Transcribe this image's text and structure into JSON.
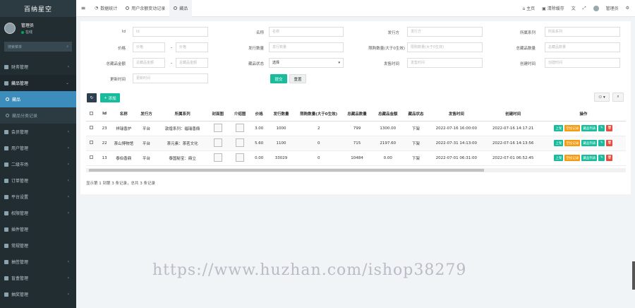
{
  "brand": "百纳星空",
  "user": {
    "name": "管理员",
    "status": "在线"
  },
  "sidebar": {
    "search_placeholder": "搜索菜单",
    "items": [
      {
        "label": "财务管理",
        "icon": "money-icon"
      },
      {
        "label": "藏品管理",
        "icon": "gallery-icon",
        "open": true
      },
      {
        "label": "会员管理",
        "icon": "user-icon"
      },
      {
        "label": "用户管理",
        "icon": "users-icon"
      },
      {
        "label": "二级市场",
        "icon": "market-icon"
      },
      {
        "label": "订单管理",
        "icon": "order-icon"
      },
      {
        "label": "平台设置",
        "icon": "gear-icon"
      },
      {
        "label": "权限管理",
        "icon": "lock-icon"
      },
      {
        "label": "插件管理",
        "icon": "puzzle-icon"
      },
      {
        "label": "常规管理",
        "icon": "cog-icon"
      },
      {
        "label": "抽签管理",
        "icon": "list-icon"
      },
      {
        "label": "盲盒管理",
        "icon": "box-icon"
      },
      {
        "label": "抽奖管理",
        "icon": "gift-icon"
      }
    ],
    "submenu": [
      {
        "label": "藏品",
        "active": true
      },
      {
        "label": "藏品分类记录",
        "active": false
      }
    ]
  },
  "topbar": {
    "tabs": [
      {
        "label": "数据统计"
      },
      {
        "label": "用户余额变动记录"
      },
      {
        "label": "藏品"
      }
    ],
    "right": {
      "home": "主页",
      "clear_cache": "清除缓存",
      "admin": "管理员"
    }
  },
  "filters": {
    "row1": [
      {
        "label": "Id",
        "placeholder": "Id"
      },
      {
        "label": "名称",
        "placeholder": "名称"
      },
      {
        "label": "发行方",
        "placeholder": "发行方"
      },
      {
        "label": "所属系列",
        "placeholder": "所属系列"
      }
    ],
    "row2": [
      {
        "label": "价格",
        "placeholder_from": "价格",
        "placeholder_to": "价格"
      },
      {
        "label": "发行数量",
        "placeholder": "发行数量"
      },
      {
        "label": "限购数量(大于0生效)",
        "placeholder": "限购数量(大于0生效)"
      },
      {
        "label": "总藏品数量",
        "placeholder": "总藏品数量"
      }
    ],
    "row3": [
      {
        "label": "总藏品金额",
        "placeholder_from": "总藏品金额",
        "placeholder_to": "总藏品金额"
      },
      {
        "label": "藏品状态",
        "value": "选择"
      },
      {
        "label": "发售时间",
        "placeholder": "发售时间"
      },
      {
        "label": "创建时间",
        "placeholder": "创建时间"
      }
    ],
    "row4": [
      {
        "label": "更新时间",
        "placeholder": "更新时间"
      }
    ],
    "submit_label": "提交",
    "reset_label": "重置"
  },
  "toolbar": {
    "add_label": "添加"
  },
  "table": {
    "headers": [
      "Id",
      "名称",
      "发行方",
      "所属系列",
      "封面图",
      "介绍图",
      "价格",
      "发行数量",
      "限购数量(大于0生效)",
      "总藏品数量",
      "总藏品金额",
      "藏品状态",
      "发售时间",
      "创建时间",
      "操作"
    ],
    "rows": [
      {
        "id": "23",
        "name": "祥瑞香炉",
        "issuer": "平台",
        "series": "敦煌系列：福瑞香鼎",
        "price": "3.00",
        "qty": "1000",
        "limit": "2",
        "total": "799",
        "amount": "1300.00",
        "status": "下架",
        "sale_time": "2022-07-16 16:00:00",
        "created": "2022-07-16 14:17:21"
      },
      {
        "id": "22",
        "name": "茶山博物馆",
        "issuer": "平台",
        "series": "茶元素：茶茗文化",
        "price": "5.60",
        "qty": "1100",
        "limit": "0",
        "total": "715",
        "amount": "2197.60",
        "status": "下架",
        "sale_time": "2022-07-31 14:13:00",
        "created": "2022-07-16 14:13:56"
      },
      {
        "id": "13",
        "name": "泰伯香鼎",
        "issuer": "平台",
        "series": "泰国秘宝：鼎立",
        "price": "0.00",
        "qty": "33029",
        "limit": "0",
        "total": "10484",
        "amount": "0.00",
        "status": "下架",
        "sale_time": "2022-07-01 06:31:00",
        "created": "2022-07-01 06:52:45"
      }
    ],
    "row_actions": [
      "上架",
      "空投记录",
      "藏品列表"
    ]
  },
  "pager": "显示第 1 到第 3 条记录，总共 3 条记录",
  "watermark": "https://www.huzhan.com/ishop38279",
  "colors": {
    "sidebar": "#222d32",
    "accent": "#3c8dbc",
    "success": "#18bc9c",
    "warning": "#f39c12",
    "danger": "#e74c3c"
  }
}
